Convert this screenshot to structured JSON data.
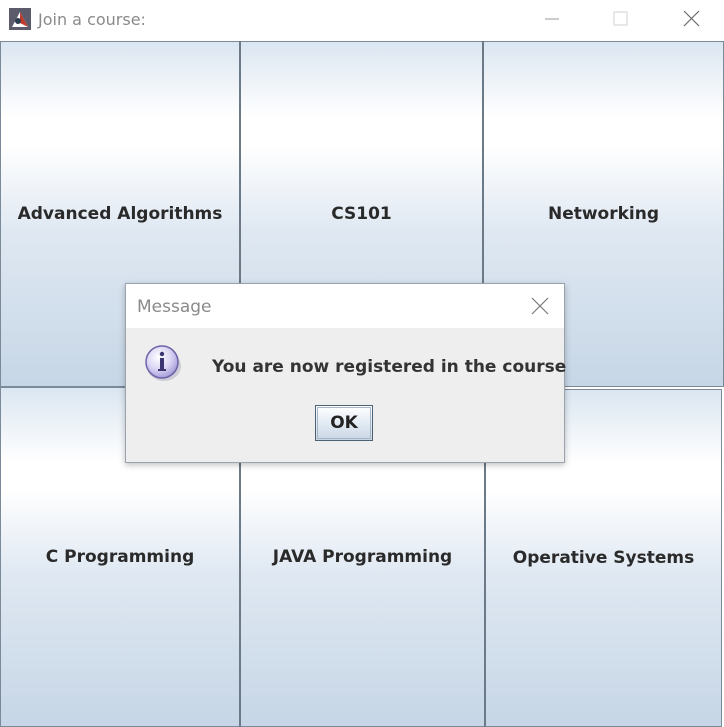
{
  "window": {
    "title": "Join a course:",
    "icon": "java-app-icon",
    "controls": [
      "minimize-icon",
      "maximize-icon",
      "close-icon"
    ]
  },
  "courses": [
    {
      "label": "Advanced Algorithms"
    },
    {
      "label": "CS101"
    },
    {
      "label": "Networking"
    },
    {
      "label": "C Programming"
    },
    {
      "label": "JAVA Programming"
    },
    {
      "label": "Operative Systems"
    }
  ],
  "dialog": {
    "title": "Message",
    "message": "You are now registered in the course",
    "icon": "info-icon",
    "ok_label": "OK"
  },
  "colors": {
    "button_border": "#7a8a99",
    "button_gradient_top": "#ffffff",
    "button_gradient_bottom": "#c6d6e6",
    "dialog_background": "#eeeeee",
    "title_text": "#8a8a8a"
  }
}
